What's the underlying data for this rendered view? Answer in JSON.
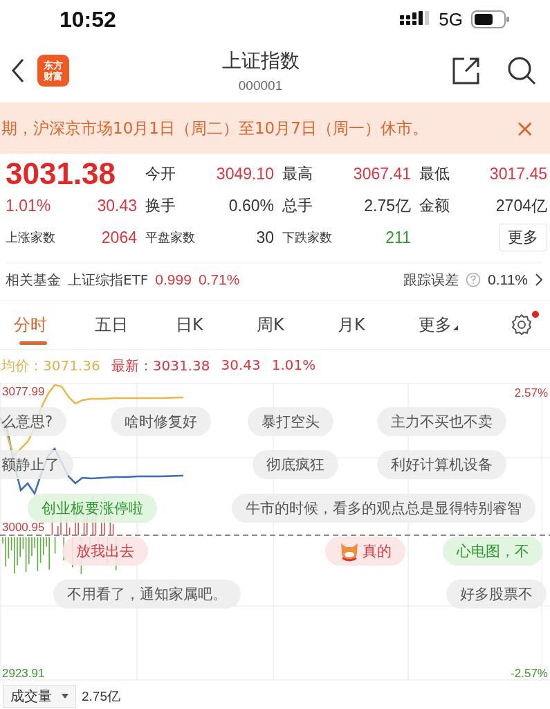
{
  "status_bar": {
    "time": "10:52",
    "network": "5G"
  },
  "header": {
    "title": "上证指数",
    "code": "000001",
    "logo_lines": [
      "东方",
      "财富"
    ]
  },
  "banner": {
    "text": "期，沪深京市场10月1日（周二）至10月7日（周一）休市。",
    "close": "×"
  },
  "quote": {
    "price": "3031.38",
    "change_pct": "1.01%",
    "change": "30.43",
    "stats": [
      {
        "label": "今开",
        "value": "3049.10",
        "color": "#d9363e"
      },
      {
        "label": "最高",
        "value": "3067.41",
        "color": "#d9363e"
      },
      {
        "label": "最低",
        "value": "3017.45",
        "color": "#d9363e"
      },
      {
        "label": "换手",
        "value": "0.60%",
        "color": "#333333"
      },
      {
        "label": "总手",
        "value": "2.75亿",
        "color": "#333333"
      },
      {
        "label": "金额",
        "value": "2704亿",
        "color": "#333333"
      },
      {
        "label": "上涨家数",
        "value": "2064",
        "color": "#d9363e"
      },
      {
        "label": "平盘家数",
        "value": "30",
        "color": "#333333"
      },
      {
        "label": "下跌家数",
        "value": "211",
        "color": "#2e9a2e"
      }
    ],
    "more_button": "更多"
  },
  "fund": {
    "label": "相关基金",
    "name": "上证综指ETF",
    "price": "0.999",
    "pct": "0.71%",
    "error_label": "跟踪误差",
    "error_value": "0.11%"
  },
  "tabs": [
    {
      "label": "分时",
      "selected": true
    },
    {
      "label": "五日",
      "selected": false
    },
    {
      "label": "日K",
      "selected": false
    },
    {
      "label": "周K",
      "selected": false
    },
    {
      "label": "月K",
      "selected": false
    },
    {
      "label": "更多",
      "selected": false
    }
  ],
  "settings_badge": true,
  "legend": {
    "avg_label": "均价：",
    "avg": "3071.36",
    "last_label": "最新：",
    "last": "3031.38",
    "change": "30.43",
    "pct": "1.01%"
  },
  "chart": {
    "left_labels": [
      "3077.99",
      "3000.95",
      "2923.91"
    ],
    "right_labels": [
      "2.57%",
      "-2.57%"
    ],
    "comments": [
      {
        "text": "么意思?",
        "kind": "plain"
      },
      {
        "text": "啥时修复好",
        "kind": "plain"
      },
      {
        "text": "暴打空头",
        "kind": "plain"
      },
      {
        "text": "主力不买也不卖",
        "kind": "plain"
      },
      {
        "text": "额静止了",
        "kind": "plain"
      },
      {
        "text": "彻底疯狂",
        "kind": "plain"
      },
      {
        "text": "利好计算机设备",
        "kind": "plain"
      },
      {
        "text": "创业板要涨停啦",
        "kind": "green"
      },
      {
        "text": "牛市的时候，看多的观点总是显得特别睿智",
        "kind": "plain"
      },
      {
        "text": "放我出去",
        "kind": "red"
      },
      {
        "text": "真的",
        "kind": "emoji"
      },
      {
        "text": "心电图，不",
        "kind": "green"
      },
      {
        "text": "不用看了，通知家属吧。",
        "kind": "plain"
      },
      {
        "text": "好多股票不",
        "kind": "plain"
      }
    ]
  },
  "volume": {
    "selector": "成交量",
    "value": "2.75亿"
  }
}
